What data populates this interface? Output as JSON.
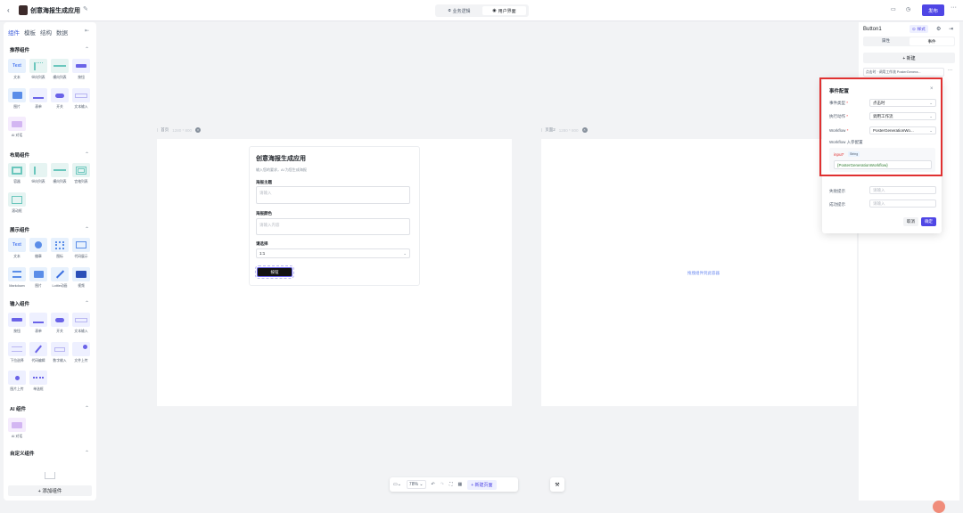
{
  "topbar": {
    "title": "创意海报生成应用",
    "tab_logic": "业务逻辑",
    "tab_ui": "用户界面",
    "publish": "发布"
  },
  "left": {
    "tabs": [
      "组件",
      "模板",
      "结构",
      "数据"
    ],
    "sections": {
      "recommended": "推荐组件",
      "layout": "布局组件",
      "display": "展示组件",
      "input": "输入组件",
      "ai": "AI 组件",
      "custom": "自定义组件"
    },
    "rec_items": [
      "文本",
      "纵向列表",
      "横向列表",
      "按钮",
      "图片",
      "表单",
      "开关",
      "文本输入",
      "AI 对话"
    ],
    "layout_items": [
      "容器",
      "纵向列表",
      "横向列表",
      "宫格列表",
      "滚动框"
    ],
    "display_items": [
      "文本",
      "徽章",
      "图标",
      "代码展示",
      "Markdown",
      "图片",
      "Lottie动画",
      "视频"
    ],
    "input_items": [
      "按钮",
      "表单",
      "开关",
      "文本输入",
      "下拉选择",
      "代码编辑",
      "数字输入",
      "文件上传",
      "图片上传",
      "单选框"
    ],
    "ai_items": [
      "AI 对话"
    ],
    "text_thumb": "Text",
    "add_component": "添加组件"
  },
  "canvas": {
    "page1_tag": "首页",
    "page1_size": "1280 * 800",
    "page2_tag": "页面2",
    "page2_size": "1280 * 800",
    "app_title": "创意海报生成应用",
    "app_sub": "输入您的要求，AI 为您生成海报",
    "f1_label": "海报主题",
    "f1_ph": "请输入",
    "f2_label": "海报颜色",
    "f2_ph": "请输入内容",
    "f3_label": "请选择",
    "f3_value": "1:1",
    "submit": "按钮",
    "empty_hint": "拖拽组件到此容器",
    "zoom": "78%",
    "new_page": "新建页面"
  },
  "right": {
    "component": "Button1",
    "style_btn": "样式",
    "tab_props": "属性",
    "tab_events": "事件",
    "new_btn": "新建",
    "event_item": "点击时 · 调用工作流 PosterGenera..."
  },
  "modal": {
    "title": "事件配置",
    "event_type_label": "事件类型",
    "event_type_value": "点击时",
    "action_label": "执行动作",
    "action_value": "调用工作流",
    "workflow_label": "Workflow",
    "workflow_value": "PosterGenerationWo...",
    "params_label": "Workflow 入参配置",
    "input_label": "input",
    "input_type": "String",
    "input_value": "{PosterGenerationWorkflow}",
    "fail_label": "失败提示",
    "fail_ph": "请输入",
    "success_label": "成功提示",
    "success_ph": "请输入",
    "cancel": "取消",
    "ok": "确定"
  },
  "colors": {
    "accent": "#4f46e5",
    "highlight": "#e03131"
  }
}
